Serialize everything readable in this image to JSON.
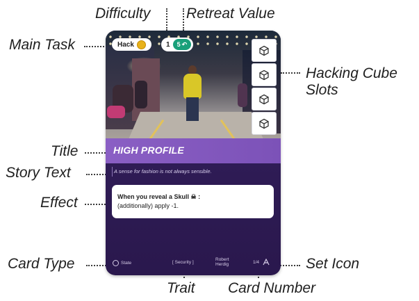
{
  "callouts": {
    "difficulty": "Difficulty",
    "retreat_value": "Retreat Value",
    "main_task": "Main Task",
    "hacking_cube_line1": "Hacking Cube",
    "hacking_cube_line2": "Slots",
    "title": "Title",
    "story_text": "Story Text",
    "effect": "Effect",
    "card_type": "Card Type",
    "set_icon": "Set Icon",
    "trait": "Trait",
    "card_number": "Card Number"
  },
  "card": {
    "task_label": "Hack",
    "task_icon": "gear-coin-icon",
    "difficulty": "1",
    "retreat_value": "5",
    "retreat_icon": "retreat-arrow-icon",
    "hacking_slots": 4,
    "slot_icon": "cube-icon",
    "title": "HIGH PROFILE",
    "story": "A sense for fashion is not always sensible.",
    "effect_line1": "When you reveal a Skull ☠ :",
    "effect_line2": "(additionally) apply -1.",
    "card_type": "State",
    "trait": "[ Security ]",
    "artist_line1": "Robert",
    "artist_line2": "Herdig",
    "card_number": "1/4",
    "set_icon": "set-symbol-icon"
  },
  "colors": {
    "card_bg": "#2e1b54",
    "title_bar": "#8a5fc4",
    "retreat_pill": "#19a07a",
    "task_icon": "#e8b21a"
  }
}
